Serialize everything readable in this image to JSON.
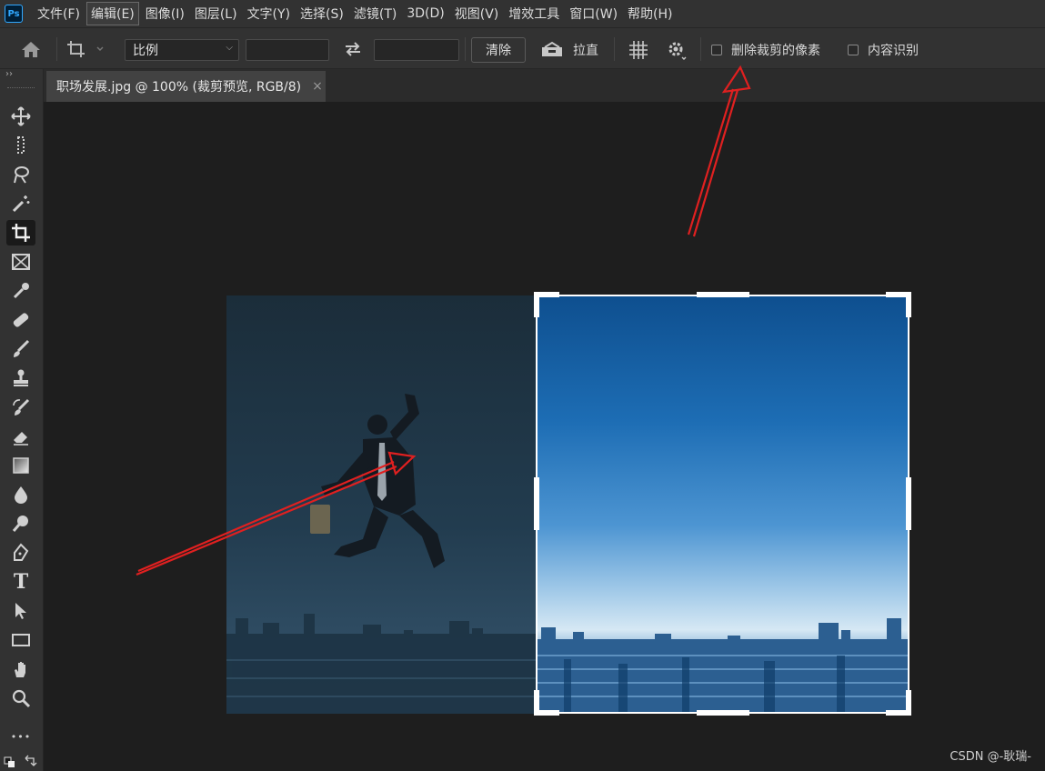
{
  "app": {
    "logo": "Ps"
  },
  "menu": [
    "文件(F)",
    "编辑(E)",
    "图像(I)",
    "图层(L)",
    "文字(Y)",
    "选择(S)",
    "滤镜(T)",
    "3D(D)",
    "视图(V)",
    "增效工具",
    "窗口(W)",
    "帮助(H)"
  ],
  "options": {
    "ratio_select": "比例",
    "clear_label": "清除",
    "straighten_label": "拉直",
    "delete_cropped_label": "删除裁剪的像素",
    "content_aware_label": "内容识别"
  },
  "document": {
    "tab_title": "职场发展.jpg @ 100% (裁剪预览, RGB/8)",
    "close_glyph": "×"
  },
  "toolbar": {
    "collapse_glyph": "››",
    "tools": [
      "move-tool",
      "marquee-tool",
      "lasso-tool",
      "magic-wand-tool",
      "crop-tool",
      "frame-tool",
      "eyedropper-tool",
      "healing-brush-tool",
      "brush-tool",
      "clone-stamp-tool",
      "history-brush-tool",
      "eraser-tool",
      "gradient-tool",
      "blur-tool",
      "dodge-tool",
      "pen-tool",
      "type-tool",
      "path-selection-tool",
      "rectangle-tool",
      "hand-tool",
      "zoom-tool",
      "more-tools"
    ],
    "selected": "crop-tool",
    "more_glyph": "•••",
    "type_glyph": "T"
  },
  "watermark": "CSDN @-耿瑞-",
  "colors": {
    "annotation_arrow": "#e02020",
    "panel": "#323232",
    "canvas": "#1e1e1e",
    "accent": "#31a8ff"
  }
}
